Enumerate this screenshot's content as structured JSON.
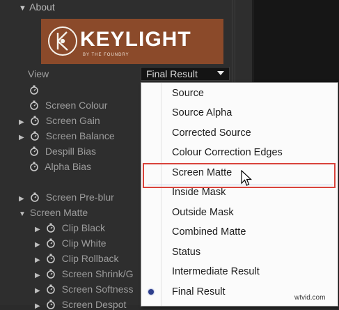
{
  "about": {
    "label": "About"
  },
  "banner": {
    "brand": "KEYLIGHT",
    "sub": "BY THE FOUNDRY"
  },
  "view": {
    "label": "View",
    "value": "Final Result"
  },
  "properties": [
    {
      "label": "",
      "expand": false
    },
    {
      "label": "Screen Colour",
      "expand": false
    },
    {
      "label": "Screen Gain",
      "expand": true
    },
    {
      "label": "Screen Balance",
      "expand": true
    },
    {
      "label": "Despill Bias",
      "expand": false
    },
    {
      "label": "Alpha Bias",
      "expand": false
    },
    {
      "label": "Screen Pre-blur",
      "expand": true
    },
    {
      "label": "Screen Matte",
      "expand": "open"
    },
    {
      "label": "Clip Black",
      "expand": true
    },
    {
      "label": "Clip White",
      "expand": true
    },
    {
      "label": "Clip Rollback",
      "expand": true
    },
    {
      "label": "Screen Shrink/G",
      "expand": true
    },
    {
      "label": "Screen Softness",
      "expand": true
    },
    {
      "label": "Screen Despot",
      "expand": true
    }
  ],
  "menu": {
    "items": [
      "Source",
      "Source Alpha",
      "Corrected Source",
      "Colour Correction Edges",
      "Screen Matte",
      "Inside Mask",
      "Outside Mask",
      "Combined Matte",
      "Status",
      "Intermediate Result",
      "Final Result"
    ],
    "selected": "Final Result",
    "hovered": "Screen Matte"
  },
  "watermark": "wtvid.com",
  "colors": {
    "banner": "#8b4a2a",
    "highlight": "#d9433b",
    "panel": "#2e2e2e"
  }
}
